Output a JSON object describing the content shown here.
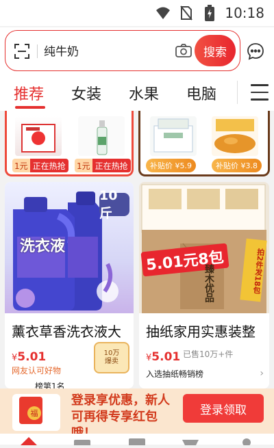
{
  "status": {
    "time": "10:18"
  },
  "search": {
    "query": "纯牛奶",
    "button": "搜索"
  },
  "tabs": [
    "推荐",
    "女装",
    "水果",
    "电脑"
  ],
  "top_cards": {
    "left": [
      {
        "prefix": "1元",
        "label": "正在热抢"
      },
      {
        "prefix": "1元",
        "label": "正在热抢"
      }
    ],
    "right": [
      {
        "label": "补贴价 ¥5.9"
      },
      {
        "label": "补贴价 ¥3.8"
      }
    ]
  },
  "products": [
    {
      "title": "薰衣草香洗衣液大",
      "currency": "¥",
      "price": "5.01",
      "subtitle": "网友认可好物",
      "badge_line1": "10万",
      "badge_line2": "爆卖",
      "image_overlay": "10斤",
      "image_text": "洗衣液",
      "partial_text": "榜第1名"
    },
    {
      "title": "抽纸家用实惠装整",
      "currency": "¥",
      "price": "5.01",
      "sold": "已售10万+件",
      "rank_text": "入选抽纸畅销榜",
      "image_banner": "5.01元8包",
      "image_side": "拍2件发18包",
      "image_box_text": "臻木优品"
    }
  ],
  "promo": {
    "text": "登录享优惠，新人可再得专享红包哦！",
    "button": "登录领取",
    "envelope_text": "福"
  }
}
